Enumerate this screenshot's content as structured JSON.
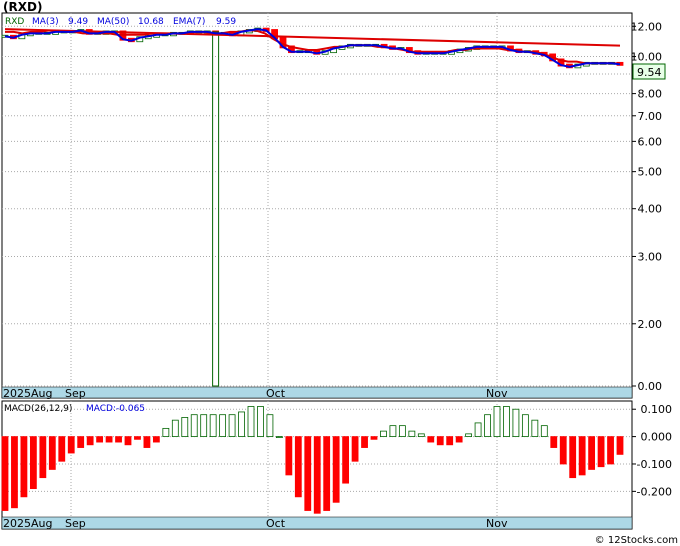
{
  "ticker_title": "(RXD)",
  "legend": {
    "symbol": "RXD",
    "ma3_label": "MA(3)",
    "ma3_value": "9.49",
    "ma50_label": "MA(50)",
    "ma50_value": "10.68",
    "ema7_label": "EMA(7)",
    "ema7_value": "9.59"
  },
  "last_price_badge": "9.54",
  "macd_legend": {
    "params": "MACD(26,12,9)",
    "value_text": "MACD:-0.065"
  },
  "watermark": "© 12Stocks.com",
  "month_labels": [
    "2025Aug",
    "Sep",
    "Oct",
    "Nov"
  ],
  "colors": {
    "up": "#006400",
    "down": "#ff0000",
    "ma": "#dd0000",
    "ma3": "#0000dd",
    "axis_band": "#add8e6",
    "grid": "#aaaaaa"
  },
  "chart_data": [
    {
      "type": "line",
      "title": "(RXD)",
      "yscale": "log",
      "y_ticks": [
        "12.00",
        "10.00",
        "9.00",
        "8.00",
        "7.00",
        "6.00",
        "5.00",
        "4.00",
        "3.00",
        "2.00",
        "0.00"
      ],
      "x_labels": [
        "2025Aug",
        "Sep",
        "Oct",
        "Nov"
      ],
      "series": [
        {
          "name": "RXD",
          "values": [
            11.3,
            11.2,
            11.4,
            11.5,
            11.5,
            11.5,
            11.6,
            11.6,
            11.6,
            11.7,
            11.5,
            11.5,
            11.6,
            11.6,
            11.1,
            11.0,
            11.2,
            11.3,
            11.4,
            11.4,
            11.5,
            11.5,
            11.6,
            11.6,
            11.6,
            11.5,
            11.5,
            11.4,
            11.6,
            11.7,
            11.8,
            11.7,
            11.2,
            10.6,
            10.3,
            10.3,
            10.3,
            10.2,
            10.3,
            10.5,
            10.6,
            10.7,
            10.7,
            10.7,
            10.7,
            10.6,
            10.5,
            10.5,
            10.3,
            10.2,
            10.2,
            10.2,
            10.2,
            10.3,
            10.4,
            10.5,
            10.6,
            10.6,
            10.6,
            10.6,
            10.4,
            10.3,
            10.3,
            10.2,
            10.1,
            9.8,
            9.5,
            9.4,
            9.5,
            9.6,
            9.6,
            9.6,
            9.6,
            9.54
          ]
        },
        {
          "name": "MA(50)",
          "values": [
            11.8,
            10.68
          ]
        },
        {
          "name": "EMA(7)",
          "values": [
            11.6,
            11.6,
            11.5,
            11.6,
            11.6,
            11.7,
            11.7,
            11.6,
            11.6,
            11.5,
            11.5,
            11.5,
            11.5,
            11.4,
            11.4,
            11.4,
            11.4,
            11.5,
            11.5,
            11.5,
            11.5,
            11.5,
            11.6,
            11.6,
            11.5,
            11.5,
            11.6,
            11.6,
            11.7,
            11.7,
            11.5,
            11.1,
            10.8,
            10.6,
            10.5,
            10.4,
            10.4,
            10.5,
            10.6,
            10.6,
            10.7,
            10.7,
            10.7,
            10.6,
            10.6,
            10.5,
            10.4,
            10.3,
            10.3,
            10.3,
            10.3,
            10.3,
            10.4,
            10.4,
            10.5,
            10.5,
            10.5,
            10.5,
            10.4,
            10.4,
            10.3,
            10.3,
            10.2,
            10.0,
            9.8,
            9.7,
            9.7,
            9.6,
            9.6,
            9.6,
            9.6,
            9.59
          ]
        }
      ]
    },
    {
      "type": "bar",
      "title": "MACD(26,12,9)",
      "y_ticks": [
        "0.100",
        "0.000",
        "-0.100",
        "-0.200"
      ],
      "ylim": [
        -0.29,
        0.13
      ],
      "x_labels": [
        "2025Aug",
        "Sep",
        "Oct",
        "Nov"
      ],
      "series": [
        {
          "name": "MACD",
          "values": [
            -0.27,
            -0.26,
            -0.22,
            -0.19,
            -0.15,
            -0.12,
            -0.09,
            -0.06,
            -0.04,
            -0.03,
            -0.02,
            -0.02,
            -0.02,
            -0.03,
            -0.01,
            -0.04,
            -0.02,
            0.03,
            0.06,
            0.07,
            0.08,
            0.08,
            0.08,
            0.08,
            0.08,
            0.09,
            0.11,
            0.11,
            0.08,
            0.0,
            -0.14,
            -0.22,
            -0.27,
            -0.28,
            -0.27,
            -0.24,
            -0.17,
            -0.09,
            -0.04,
            -0.01,
            0.02,
            0.04,
            0.04,
            0.02,
            0.01,
            -0.02,
            -0.03,
            -0.03,
            -0.02,
            0.01,
            0.05,
            0.08,
            0.11,
            0.11,
            0.1,
            0.08,
            0.06,
            0.04,
            -0.04,
            -0.1,
            -0.15,
            -0.14,
            -0.12,
            -0.11,
            -0.1,
            -0.065
          ]
        }
      ]
    }
  ]
}
